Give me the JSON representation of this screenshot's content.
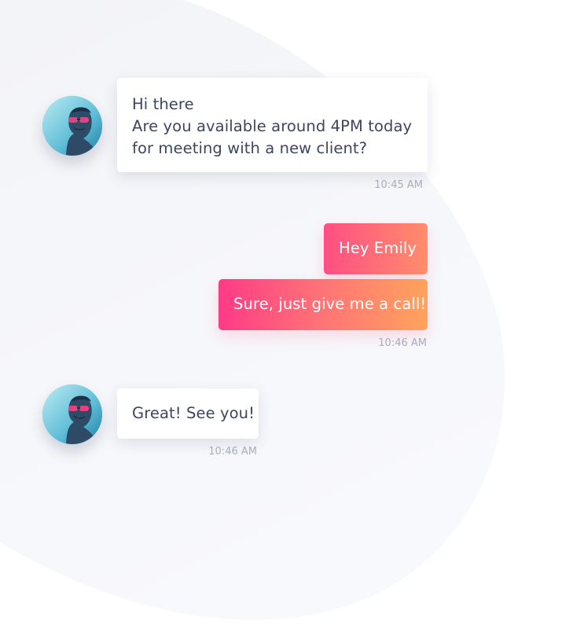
{
  "conversation": {
    "messages": [
      {
        "sender": "contact",
        "lines": [
          "Hi there",
          "Are you available around 4PM today",
          "for meeting with a new client?"
        ],
        "time": "10:45 AM"
      },
      {
        "sender": "me",
        "lines": [
          "Hey Emily"
        ]
      },
      {
        "sender": "me",
        "lines": [
          "Sure, just give me a call!"
        ],
        "time": "10:46 AM"
      },
      {
        "sender": "contact",
        "lines": [
          "Great! See you!"
        ],
        "time": "10:46 AM"
      }
    ]
  },
  "colors": {
    "incoming_bubble": "#ffffff",
    "incoming_text": "#3d4660",
    "outgoing_gradient_start": "#ff3f86",
    "outgoing_gradient_end": "#ffa25c",
    "timestamp": "#a7adb9",
    "background_blob": "#f4f5f9"
  },
  "icons": {
    "contact_avatar": "person-with-sunglasses-avatar"
  }
}
